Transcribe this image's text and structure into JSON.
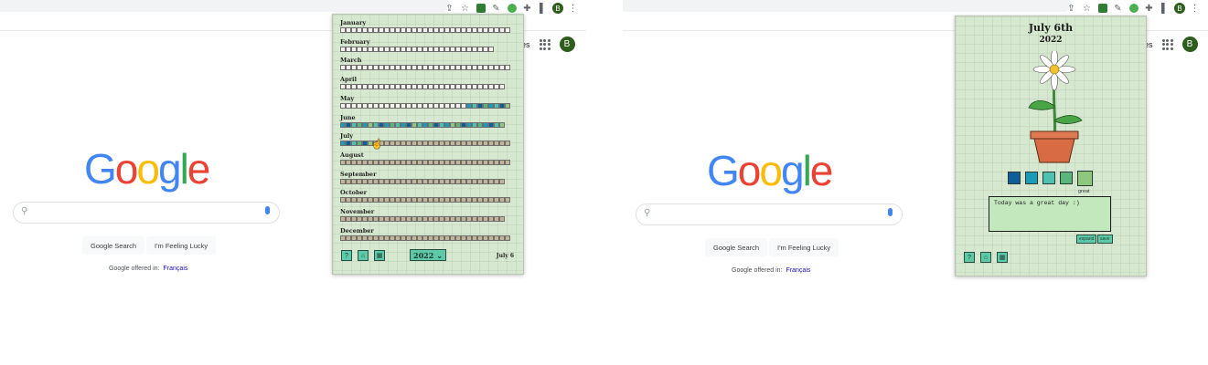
{
  "left": {
    "toolbar_avatar": "B",
    "google_header_link": "ges",
    "google_avatar": "B",
    "google_logo": [
      "G",
      "o",
      "o",
      "g",
      "l",
      "e"
    ],
    "google_logo_colors": [
      "#4285f4",
      "#ea4335",
      "#fbbc05",
      "#4285f4",
      "#34a853",
      "#ea4335"
    ],
    "search_button": "Google Search",
    "lucky_button": "I'm Feeling Lucky",
    "offered_in": "Google offered in:",
    "offered_language": "Français"
  },
  "calendar": {
    "months": [
      "January",
      "February",
      "March",
      "April",
      "May",
      "June",
      "July",
      "August",
      "September",
      "October",
      "November",
      "December"
    ],
    "year": "2022",
    "current_date": "July 6",
    "buttons": {
      "help": "?",
      "home": "⌂",
      "calendar": "▦"
    },
    "mood_palette": [
      "#0d5e9a",
      "#1a9bb8",
      "#4dc2b0",
      "#5bb67d",
      "#8ec77e"
    ],
    "colored_days": {
      "May": [
        "#1a9bb8",
        "#4dc2b0",
        "#0d5e9a",
        "#5bb67d",
        "#1a9bb8",
        "#4dc2b0",
        "#0d5e9a",
        "#8ec77e"
      ],
      "June": [
        "#1a9bb8",
        "#0d5e9a",
        "#4dc2b0",
        "#5bb67d",
        "#1a9bb8",
        "#8ec77e",
        "#4dc2b0",
        "#0d5e9a",
        "#1a9bb8",
        "#5bb67d",
        "#4dc2b0",
        "#1a9bb8",
        "#0d5e9a",
        "#8ec77e",
        "#4dc2b0",
        "#1a9bb8",
        "#5bb67d",
        "#0d5e9a",
        "#4dc2b0",
        "#1a9bb8",
        "#8ec77e",
        "#5bb67d",
        "#0d5e9a",
        "#1a9bb8",
        "#4dc2b0",
        "#5bb67d",
        "#1a9bb8",
        "#0d5e9a",
        "#4dc2b0",
        "#8ec77e"
      ],
      "July": [
        "#1a9bb8",
        "#0d5e9a",
        "#4dc2b0",
        "#5bb67d",
        "#0d5e9a",
        "#8ec77e"
      ]
    }
  },
  "right": {
    "toolbar_avatar": "B",
    "google_header_link": "ges",
    "google_avatar": "B",
    "search_button": "Google Search",
    "lucky_button": "I'm Feeling Lucky",
    "offered_in": "Google offered in:",
    "offered_language": "Français"
  },
  "journal": {
    "title": "July 6th",
    "year": "2022",
    "mood_colors": [
      "#0d5e9a",
      "#1a9bb8",
      "#4dc2b0",
      "#5bb67d",
      "#8ec77e"
    ],
    "selected_mood_label": "great",
    "note_text": "Today was a great day :)",
    "expand_button": "expand",
    "save_button": "save",
    "buttons": {
      "help": "?",
      "home": "⌂",
      "calendar": "▦"
    }
  }
}
